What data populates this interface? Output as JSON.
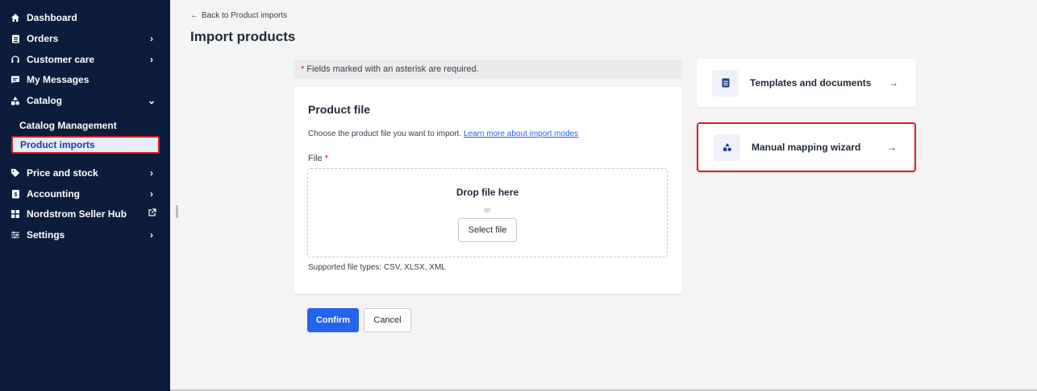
{
  "sidebar": {
    "items": [
      {
        "label": "Dashboard",
        "icon": "home-icon",
        "chevron": ""
      },
      {
        "label": "Orders",
        "icon": "clipboard-icon",
        "chevron": "›"
      },
      {
        "label": "Customer care",
        "icon": "headset-icon",
        "chevron": "›"
      },
      {
        "label": "My Messages",
        "icon": "message-icon",
        "chevron": ""
      },
      {
        "label": "Catalog",
        "icon": "catalog-icon",
        "chevron": "⌄"
      }
    ],
    "catalog_sub": {
      "management": "Catalog Management",
      "imports": "Product imports"
    },
    "items_lower": [
      {
        "label": "Price and stock",
        "icon": "tag-icon",
        "chevron": "›"
      },
      {
        "label": "Accounting",
        "icon": "accounting-icon",
        "chevron": "›"
      },
      {
        "label": "Nordstrom Seller Hub",
        "icon": "grid-icon",
        "chevron": "external-link-icon"
      },
      {
        "label": "Settings",
        "icon": "sliders-icon",
        "chevron": "›"
      }
    ]
  },
  "header": {
    "back_arrow": "←",
    "back_label": "Back to Product imports",
    "title": "Import products"
  },
  "form": {
    "required_asterisk": "*",
    "required_note": " Fields marked with an asterisk are required.",
    "card_title": "Product file",
    "description": "Choose the product file you want to import. ",
    "learn_more_link": "Learn more about import modes",
    "file_label": "File ",
    "file_asterisk": "*",
    "drop_title": "Drop file here",
    "drop_or": "or",
    "select_file": "Select file",
    "supported_types": "Supported file types: CSV, XLSX, XML"
  },
  "actions": {
    "confirm": "Confirm",
    "cancel": "Cancel"
  },
  "side_cards": [
    {
      "label": "Templates and documents",
      "icon": "document-icon",
      "arrow": "→"
    },
    {
      "label": "Manual mapping wizard",
      "icon": "shapes-icon",
      "arrow": "→"
    }
  ],
  "colors": {
    "sidebar_bg": "#0b1d3a",
    "accent": "#2563eb",
    "highlight_border": "#d0202b"
  }
}
